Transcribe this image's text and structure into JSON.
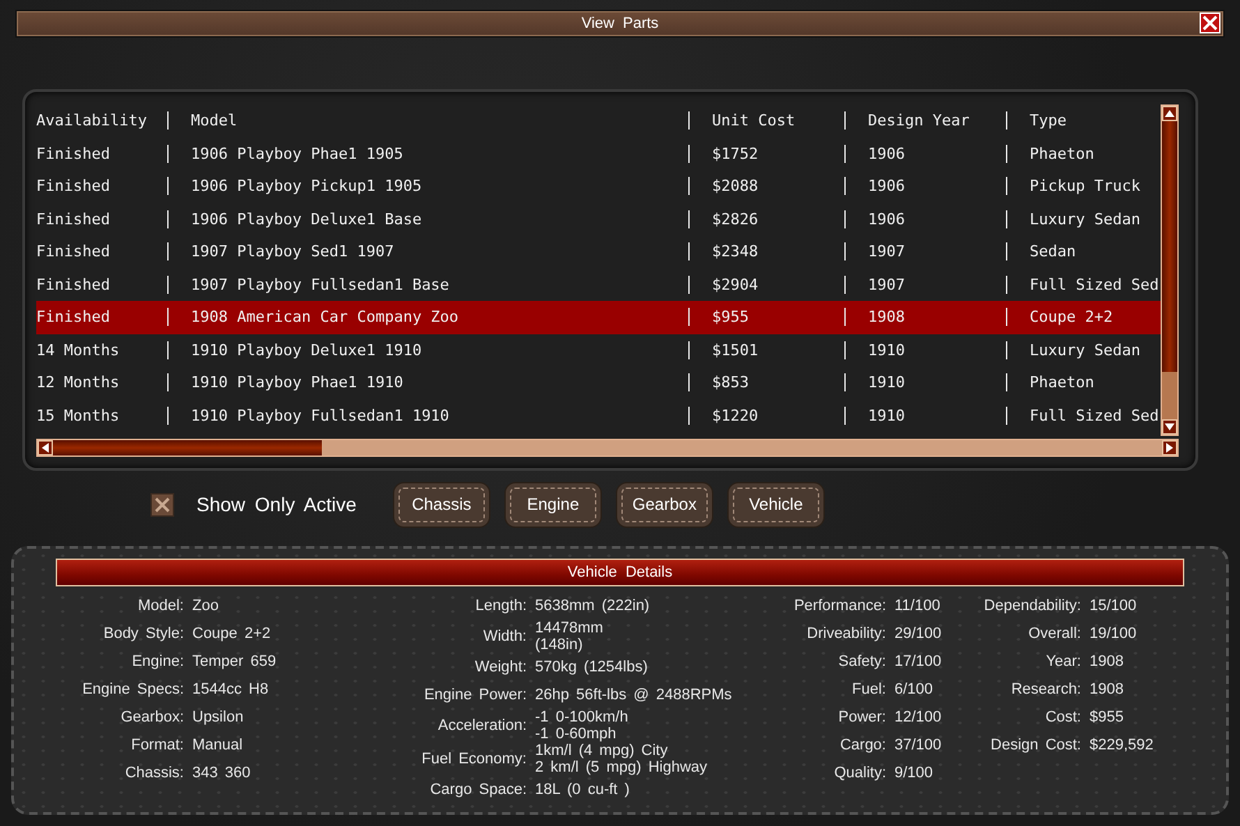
{
  "window": {
    "title": "View Parts"
  },
  "table": {
    "columns": [
      "Availability",
      "Model",
      "Unit Cost",
      "Design Year",
      "Type"
    ],
    "rows": [
      {
        "cells": [
          "Finished",
          "1906 Playboy Phae1 1905",
          "$1752",
          "1906",
          "Phaeton"
        ],
        "selected": false
      },
      {
        "cells": [
          "Finished",
          "1906 Playboy Pickup1 1905",
          "$2088",
          "1906",
          "Pickup Truck"
        ],
        "selected": false
      },
      {
        "cells": [
          "Finished",
          "1906 Playboy Deluxe1 Base",
          "$2826",
          "1906",
          "Luxury Sedan"
        ],
        "selected": false
      },
      {
        "cells": [
          "Finished",
          "1907 Playboy Sed1 1907",
          "$2348",
          "1907",
          "Sedan"
        ],
        "selected": false
      },
      {
        "cells": [
          "Finished",
          "1907 Playboy Fullsedan1 Base",
          "$2904",
          "1907",
          "Full Sized Sed"
        ],
        "selected": false
      },
      {
        "cells": [
          "Finished",
          "1908 American Car Company Zoo",
          "$955",
          "1908",
          "Coupe 2+2"
        ],
        "selected": true
      },
      {
        "cells": [
          "14 Months",
          "1910 Playboy Deluxe1 1910",
          "$1501",
          "1910",
          "Luxury Sedan"
        ],
        "selected": false
      },
      {
        "cells": [
          "12 Months",
          "1910 Playboy Phae1 1910",
          "$853",
          "1910",
          "Phaeton"
        ],
        "selected": false
      },
      {
        "cells": [
          "15 Months",
          "1910 Playboy Fullsedan1 1910",
          "$1220",
          "1910",
          "Full Sized Sed"
        ],
        "selected": false
      }
    ]
  },
  "filter": {
    "label": "Show Only Active",
    "checked": true
  },
  "buttons": [
    "Chassis",
    "Engine",
    "Gearbox",
    "Vehicle"
  ],
  "details": {
    "title": "Vehicle Details",
    "columns": [
      [
        {
          "label": "Model:",
          "value": "Zoo"
        },
        {
          "label": "Body Style:",
          "value": "Coupe 2+2"
        },
        {
          "label": "Engine:",
          "value": "Temper 659"
        },
        {
          "label": "Engine Specs:",
          "value": "1544cc H8"
        },
        {
          "label": "Gearbox:",
          "value": "Upsilon"
        },
        {
          "label": "Format:",
          "value": "Manual"
        },
        {
          "label": "Chassis:",
          "value": "343 360"
        }
      ],
      [
        {
          "label": "Length:",
          "value": "5638mm (222in)"
        },
        {
          "label": "Width:",
          "value": "14478mm\n(148in)"
        },
        {
          "label": "Weight:",
          "value": "570kg (1254lbs)"
        },
        {
          "label": "Engine Power:",
          "value": "26hp 56ft-lbs @ 2488RPMs"
        },
        {
          "label": "Acceleration:",
          "value": "-1 0-100km/h\n-1 0-60mph"
        },
        {
          "label": "Fuel Economy:",
          "value": "1km/l (4 mpg) City\n2 km/l (5 mpg) Highway"
        },
        {
          "label": "Cargo Space:",
          "value": "18L (0 cu-ft )"
        }
      ],
      [
        {
          "label": "Performance:",
          "value": "11/100"
        },
        {
          "label": "Driveability:",
          "value": "29/100"
        },
        {
          "label": "Safety:",
          "value": "17/100"
        },
        {
          "label": "Fuel:",
          "value": "6/100"
        },
        {
          "label": "Power:",
          "value": "12/100"
        },
        {
          "label": "Cargo:",
          "value": "37/100"
        },
        {
          "label": "Quality:",
          "value": "9/100"
        }
      ],
      [
        {
          "label": "Dependability:",
          "value": "15/100"
        },
        {
          "label": "Overall:",
          "value": "19/100"
        },
        {
          "label": "Year:",
          "value": "1908"
        },
        {
          "label": "Research:",
          "value": "1908"
        },
        {
          "label": "Cost:",
          "value": "$955"
        },
        {
          "label": "Design Cost:",
          "value": "$229,592"
        }
      ]
    ]
  }
}
